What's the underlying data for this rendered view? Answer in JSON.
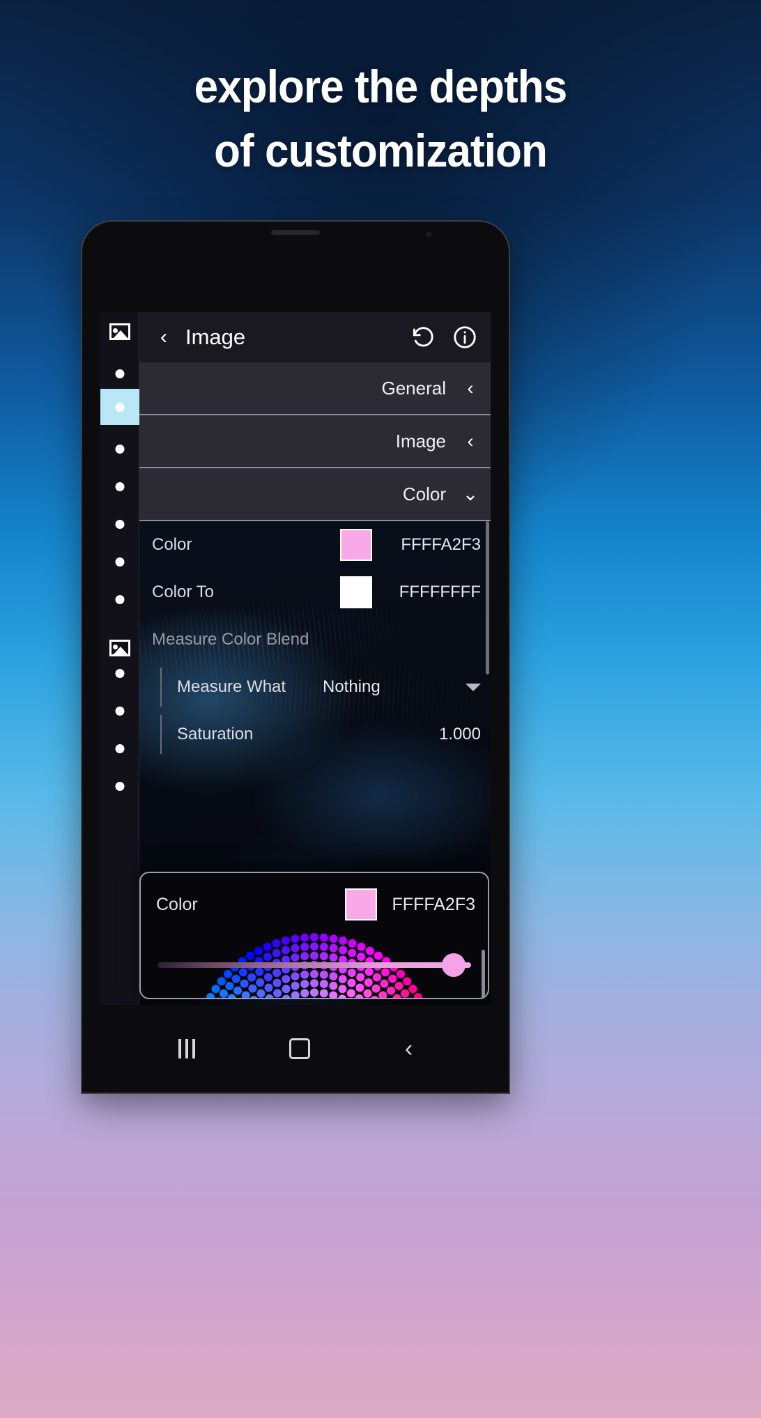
{
  "promo": {
    "headline_line1": "explore the depths",
    "headline_line2": "of customization"
  },
  "app": {
    "toolbar": {
      "app_icon": "image-icon",
      "back_label": "‹",
      "title": "Image",
      "reset_icon": "reset-icon",
      "info_icon": "info-icon"
    },
    "sections": [
      {
        "label": "General",
        "chevron": "‹",
        "expanded": false
      },
      {
        "label": "Image",
        "chevron": "‹",
        "expanded": false
      },
      {
        "label": "Color",
        "chevron": "⌄",
        "expanded": true
      }
    ],
    "properties": [
      {
        "label": "Color",
        "swatch": "#f9a8e8",
        "hex": "FFFFA2F3",
        "type": "color"
      },
      {
        "label": "Color To",
        "swatch": "#ffffff",
        "hex": "FFFFFFFF",
        "type": "color"
      },
      {
        "label": "Measure Color Blend",
        "type": "header"
      },
      {
        "label": "Measure What",
        "value": "Nothing",
        "type": "dropdown"
      },
      {
        "label": "Saturation",
        "value": "1.000",
        "type": "number"
      }
    ]
  },
  "dialog": {
    "label": "Color",
    "swatch": "#f9a8e8",
    "hex": "FFFFA2F3",
    "slider_value": 96
  },
  "navbar": {
    "recents_label": "recents-icon",
    "home_label": "home-icon",
    "back_label": "‹"
  },
  "colors": {
    "accent_pink": "#f9a8e8",
    "rail_selected": "#b9e7f5",
    "row_bg": "#2c2b33"
  }
}
